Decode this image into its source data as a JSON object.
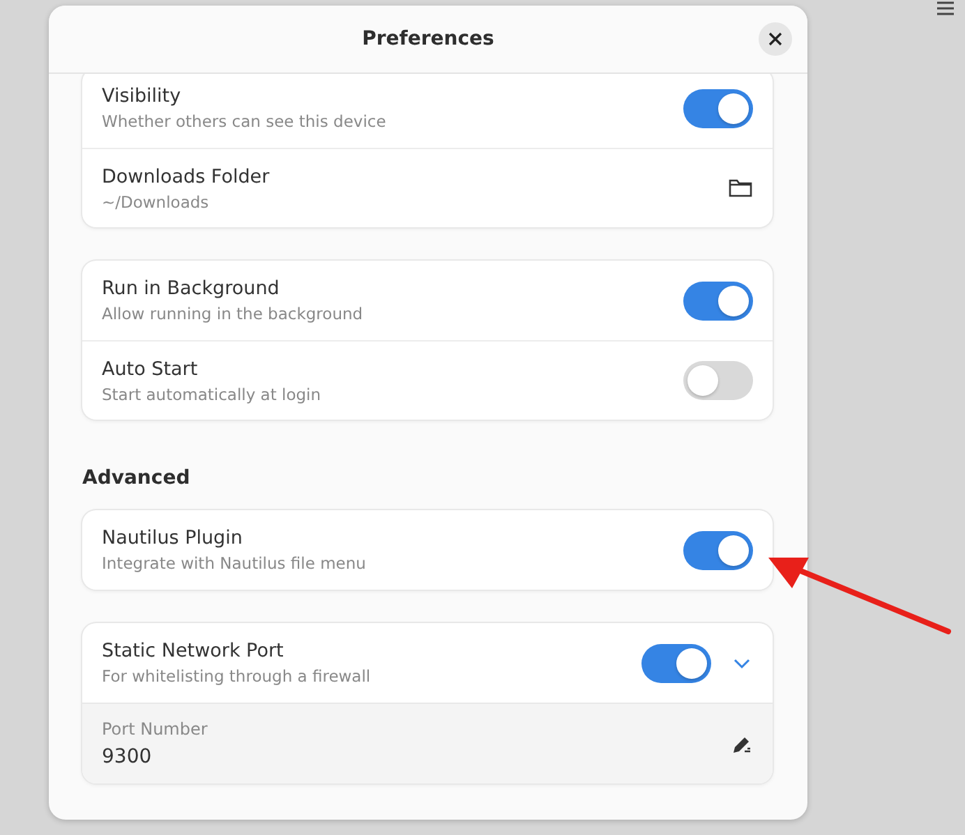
{
  "window": {
    "title": "Preferences"
  },
  "groups": [
    {
      "rows": [
        {
          "kind": "switch",
          "title": "Visibility",
          "subtitle": "Whether others can see this device",
          "on": true
        },
        {
          "kind": "folder",
          "title": "Downloads Folder",
          "subtitle": "~/Downloads"
        }
      ]
    },
    {
      "rows": [
        {
          "kind": "switch",
          "title": "Run in Background",
          "subtitle": "Allow running in the background",
          "on": true
        },
        {
          "kind": "switch",
          "title": "Auto Start",
          "subtitle": "Start automatically at login",
          "on": false
        }
      ]
    },
    {
      "title": "Advanced",
      "rows": [
        {
          "kind": "switch",
          "title": "Nautilus Plugin",
          "subtitle": "Integrate with Nautilus file menu",
          "on": true
        }
      ]
    },
    {
      "rows": [
        {
          "kind": "expander",
          "title": "Static Network Port",
          "subtitle": "For whitelisting through a firewall",
          "on": true,
          "expanded": true,
          "entry": {
            "label": "Port Number",
            "value": "9300"
          }
        }
      ]
    }
  ]
}
